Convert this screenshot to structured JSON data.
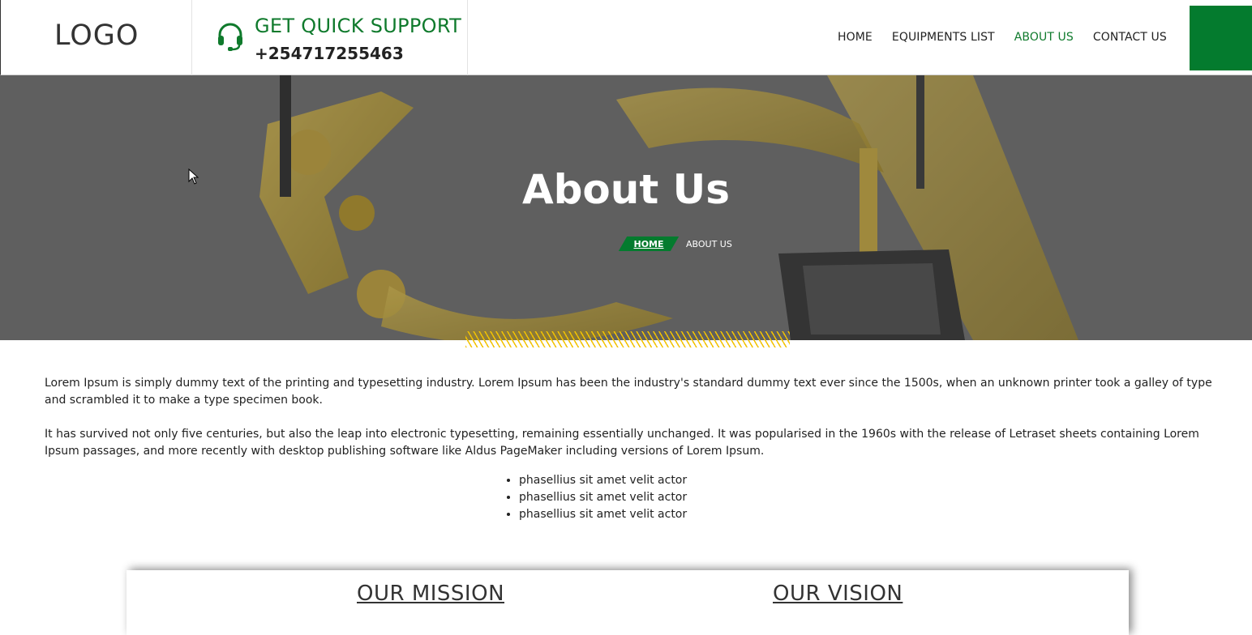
{
  "header": {
    "logo": "LOGO",
    "support_title": "GET QUICK SUPPORT",
    "support_phone": "+254717255463",
    "nav": [
      {
        "label": "HOME",
        "active": false
      },
      {
        "label": "EQUIPMENTS LIST",
        "active": false
      },
      {
        "label": "ABOUT US",
        "active": true
      },
      {
        "label": "CONTACT US",
        "active": false
      }
    ],
    "accent_color": "#047b2e"
  },
  "hero": {
    "title": "About Us",
    "breadcrumb_home": "HOME",
    "breadcrumb_current": "ABOUT US"
  },
  "content": {
    "paragraph_1": "Lorem Ipsum is simply dummy text of the printing and typesetting industry. Lorem Ipsum has been the industry's standard dummy text ever since the 1500s, when an unknown printer took a galley of type and scrambled it to make a type specimen book.",
    "paragraph_2": "It has survived not only five centuries, but also the leap into electronic typesetting, remaining essentially unchanged. It was popularised in the 1960s with the release of Letraset sheets containing Lorem Ipsum passages, and more recently with desktop publishing software like Aldus PageMaker including versions of Lorem Ipsum.",
    "bullets": [
      "phasellius sit amet velit actor",
      "phasellius sit amet velit actor",
      "phasellius sit amet velit actor"
    ]
  },
  "cards": {
    "mission_title": "OUR MISSION",
    "vision_title": "OUR VISION"
  }
}
